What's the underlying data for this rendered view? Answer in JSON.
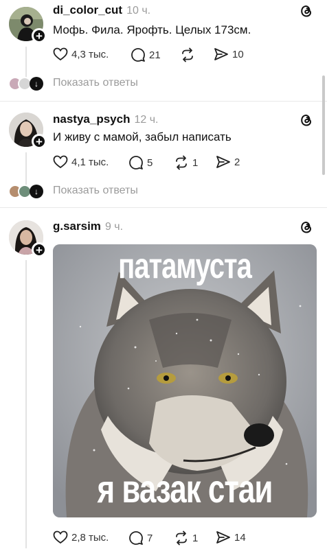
{
  "posts": [
    {
      "username": "di_color_cut",
      "time": "10 ч.",
      "text": "Мофь. Фила. Ярофть. Целых 173см.",
      "likes": "4,3 тыс.",
      "comments": "21",
      "reposts": "",
      "shares": "10",
      "show_replies": "Показать ответы"
    },
    {
      "username": "nastya_psych",
      "time": "12 ч.",
      "text": "И живу с мамой, забыл написать",
      "likes": "4,1 тыс.",
      "comments": "5",
      "reposts": "1",
      "shares": "2",
      "show_replies": "Показать ответы"
    },
    {
      "username": "g.sarsim",
      "time": "9 ч.",
      "image_caption_top": "патамуста",
      "image_caption_bottom": "я вазак стаи",
      "likes": "2,8 тыс.",
      "comments": "7",
      "reposts": "1",
      "shares": "14"
    }
  ],
  "colors": {
    "text": "#111111",
    "muted": "#9b9b9b",
    "divider": "#e8e8e8",
    "accent": "#000000"
  },
  "icons": [
    "like-icon",
    "comment-icon",
    "repost-icon",
    "share-icon",
    "threads-icon",
    "follow-plus-icon"
  ]
}
